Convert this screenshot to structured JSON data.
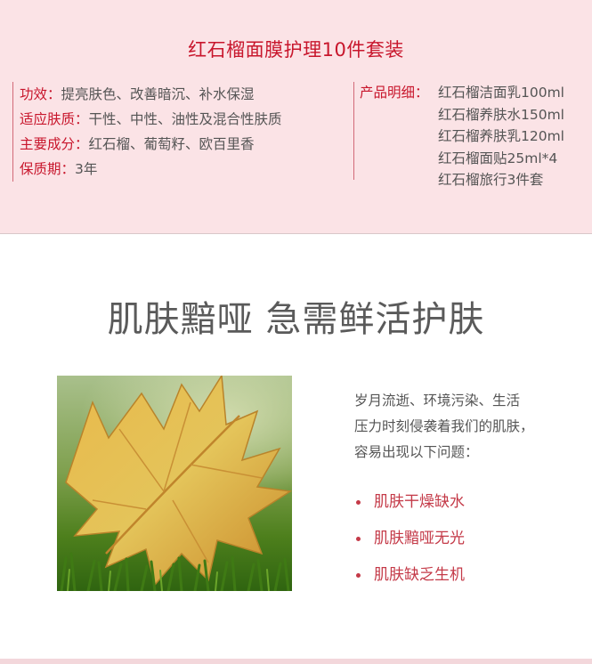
{
  "header": {
    "title": "红石榴面膜护理10件套装"
  },
  "specs": [
    {
      "label": "功效：",
      "value": "提亮肤色、改善暗沉、补水保湿"
    },
    {
      "label": "适应肤质：",
      "value": "干性、中性、油性及混合性肤质"
    },
    {
      "label": "主要成分：",
      "value": "红石榴、葡萄籽、欧百里香"
    },
    {
      "label": "保质期：",
      "value": "3年"
    }
  ],
  "products": {
    "label": "产品明细：",
    "items": [
      "红石榴洁面乳100ml",
      "红石榴养肤水150ml",
      "红石榴养肤乳120ml",
      "红石榴面贴25ml*4",
      "红石榴旅行3件套"
    ]
  },
  "section": {
    "headline": "肌肤黯哑 急需鲜活护肤",
    "intro_lines": [
      "岁月流逝、环境污染、生活",
      "压力时刻侵袭着我们的肌肤，",
      "容易出现以下问题："
    ],
    "problems": [
      "肌肤干燥缺水",
      "肌肤黯哑无光",
      "肌肤缺乏生机"
    ]
  },
  "colors": {
    "accent_red": "#c8162c",
    "panel_pink": "#fbe3e6",
    "bullet_red": "#c43a48"
  },
  "image": {
    "subject": "autumn-leaf-on-grass-photo"
  }
}
